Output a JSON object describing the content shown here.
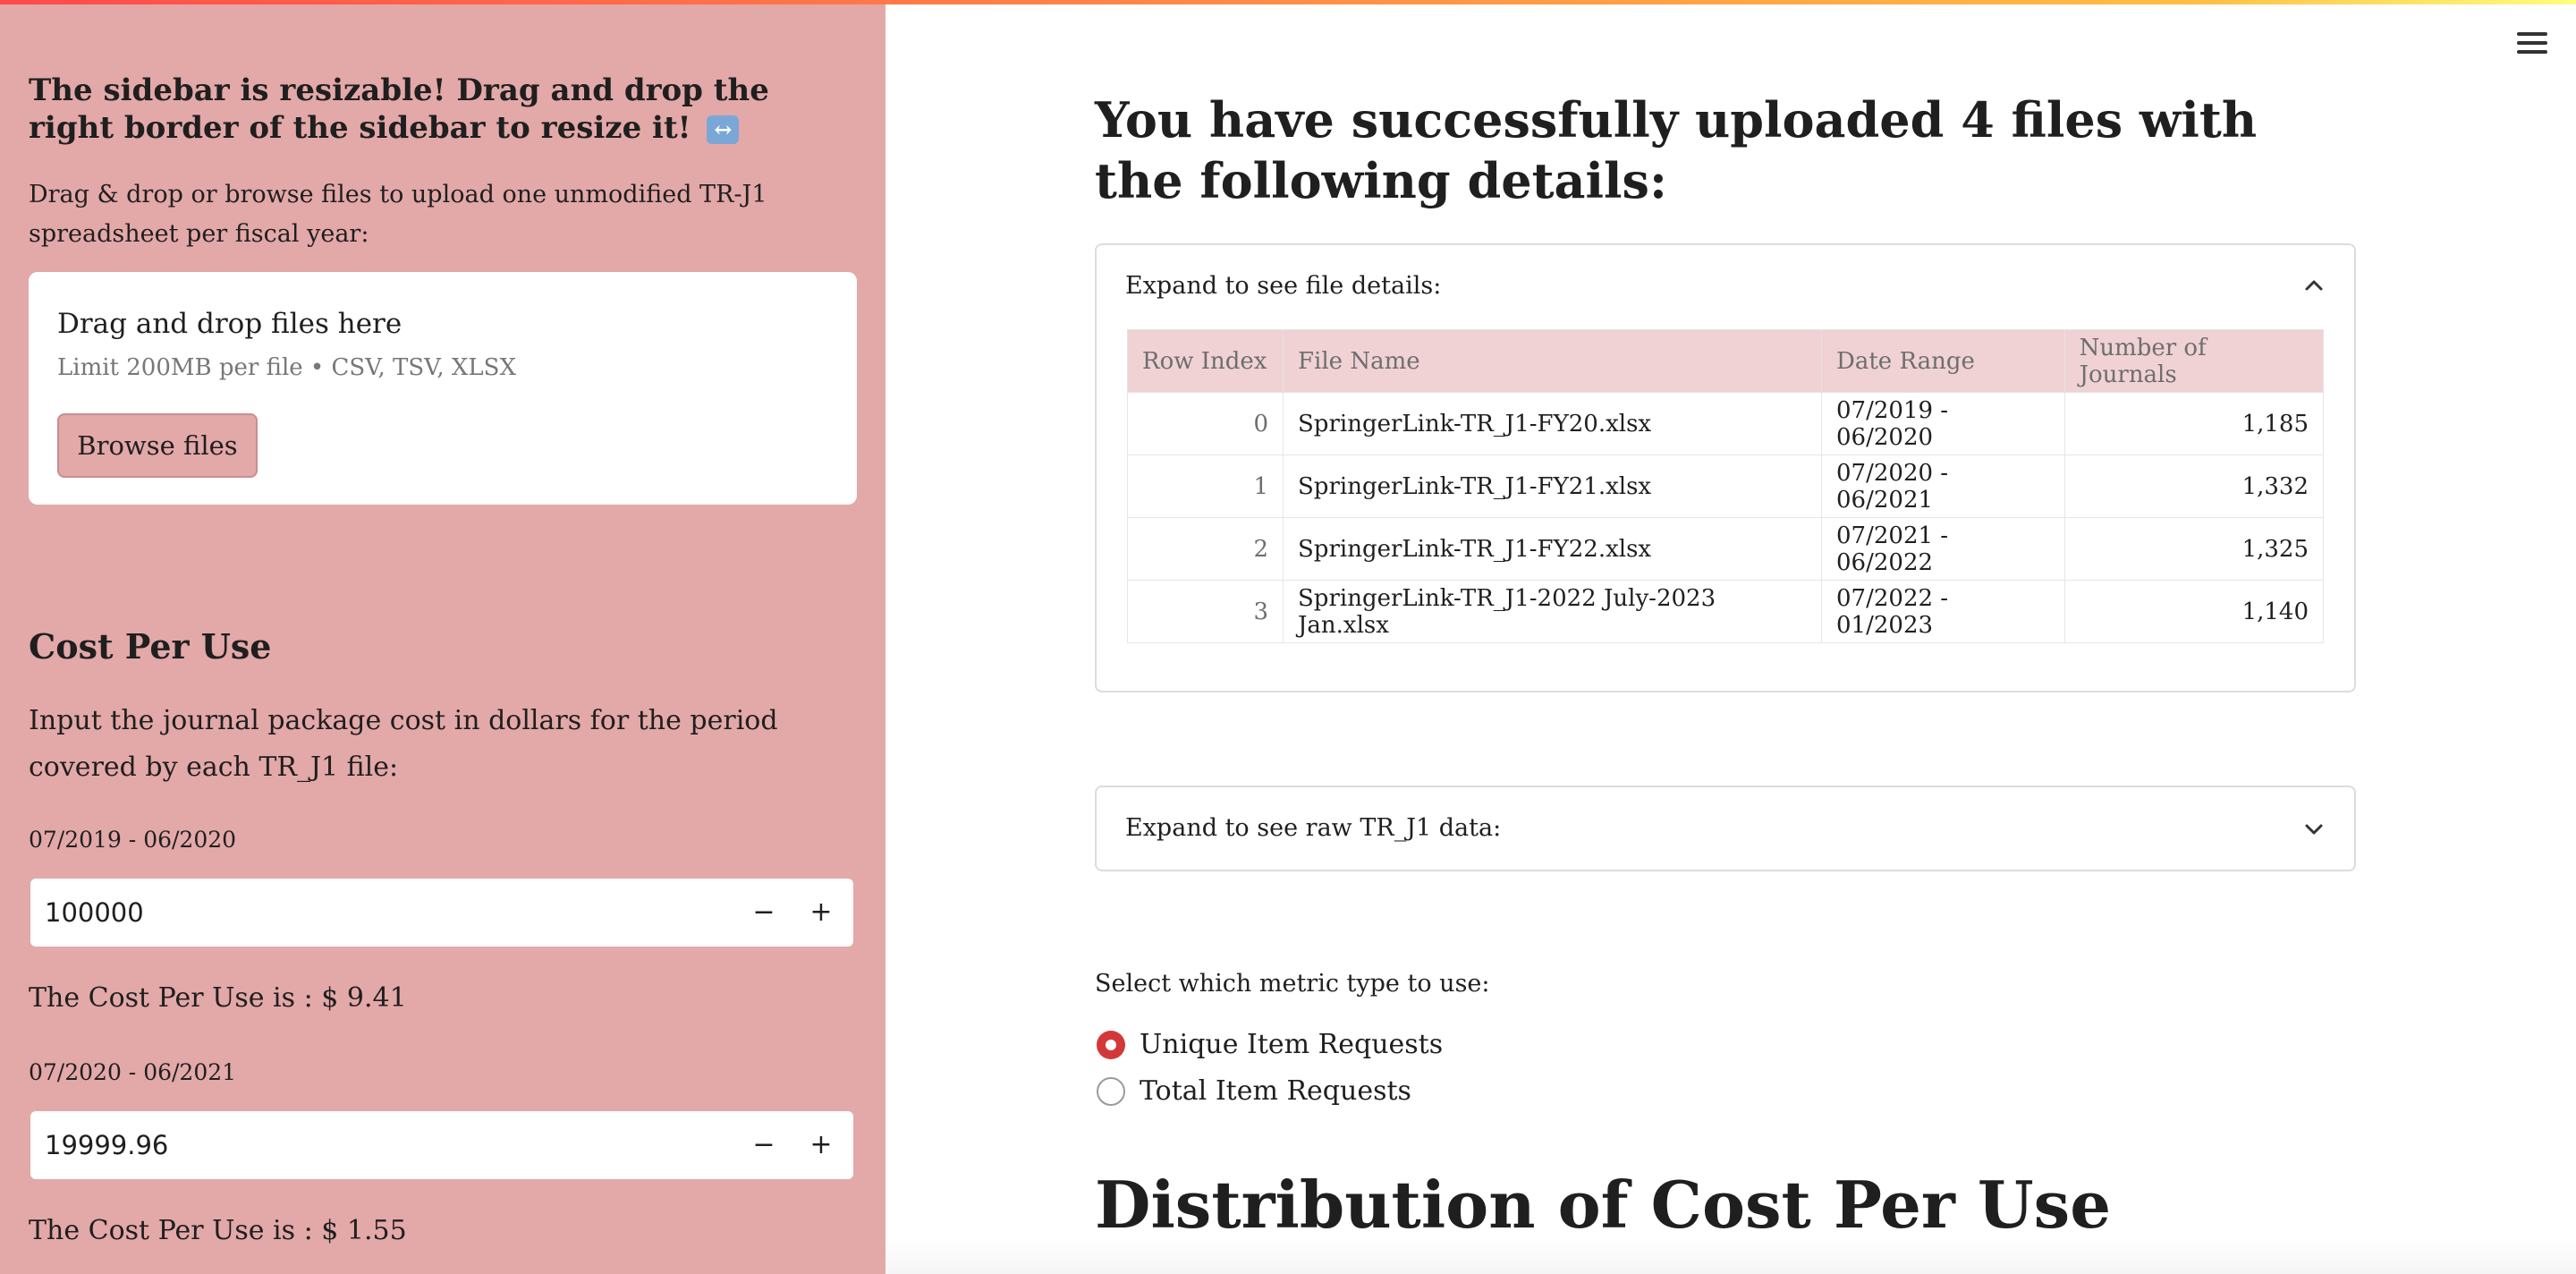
{
  "sidebar": {
    "heading": "The sidebar is resizable! Drag and drop the right border of the sidebar to resize it!",
    "heading_emoji": "↔",
    "upload_instructions": "Drag & drop or browse files to upload one unmodified TR-J1 spreadsheet per fiscal year:",
    "uploader": {
      "title": "Drag and drop files here",
      "limit": "Limit 200MB per file • CSV, TSV, XLSX",
      "browse_label": "Browse files"
    },
    "cost_per_use": {
      "title": "Cost Per Use",
      "description": "Input the journal package cost in dollars for the period covered by each TR_J1 file:",
      "periods": [
        {
          "label": "07/2019 - 06/2020",
          "value": "100000",
          "result": "The Cost Per Use is : $ 9.41"
        },
        {
          "label": "07/2020 - 06/2021",
          "value": "19999.96",
          "result": "The Cost Per Use is : $ 1.55"
        }
      ],
      "minus": "−",
      "plus": "+"
    }
  },
  "main": {
    "title": "You have successfully uploaded 4 files with the following details:",
    "file_expander": {
      "label": "Expand to see file details:",
      "expanded": true,
      "columns": [
        "Row Index",
        "File Name",
        "Date Range",
        "Number of Journals"
      ],
      "rows": [
        [
          "0",
          "SpringerLink-TR_J1-FY20.xlsx",
          "07/2019 - 06/2020",
          "1,185"
        ],
        [
          "1",
          "SpringerLink-TR_J1-FY21.xlsx",
          "07/2020 - 06/2021",
          "1,332"
        ],
        [
          "2",
          "SpringerLink-TR_J1-FY22.xlsx",
          "07/2021 - 06/2022",
          "1,325"
        ],
        [
          "3",
          "SpringerLink-TR_J1-2022 July-2023 Jan.xlsx",
          "07/2022 - 01/2023",
          "1,140"
        ]
      ]
    },
    "raw_expander": {
      "label": "Expand to see raw TR_J1 data:",
      "expanded": false
    },
    "metric": {
      "label": "Select which metric type to use:",
      "options": [
        "Unique Item Requests",
        "Total Item Requests"
      ],
      "selected": "Unique Item Requests"
    },
    "distribution_title": "Distribution of Cost Per Use"
  },
  "colors": {
    "sidebar_bg": "#e3a8a8",
    "accent_red": "#d2383a",
    "table_header_bg": "#f0d2d4"
  }
}
